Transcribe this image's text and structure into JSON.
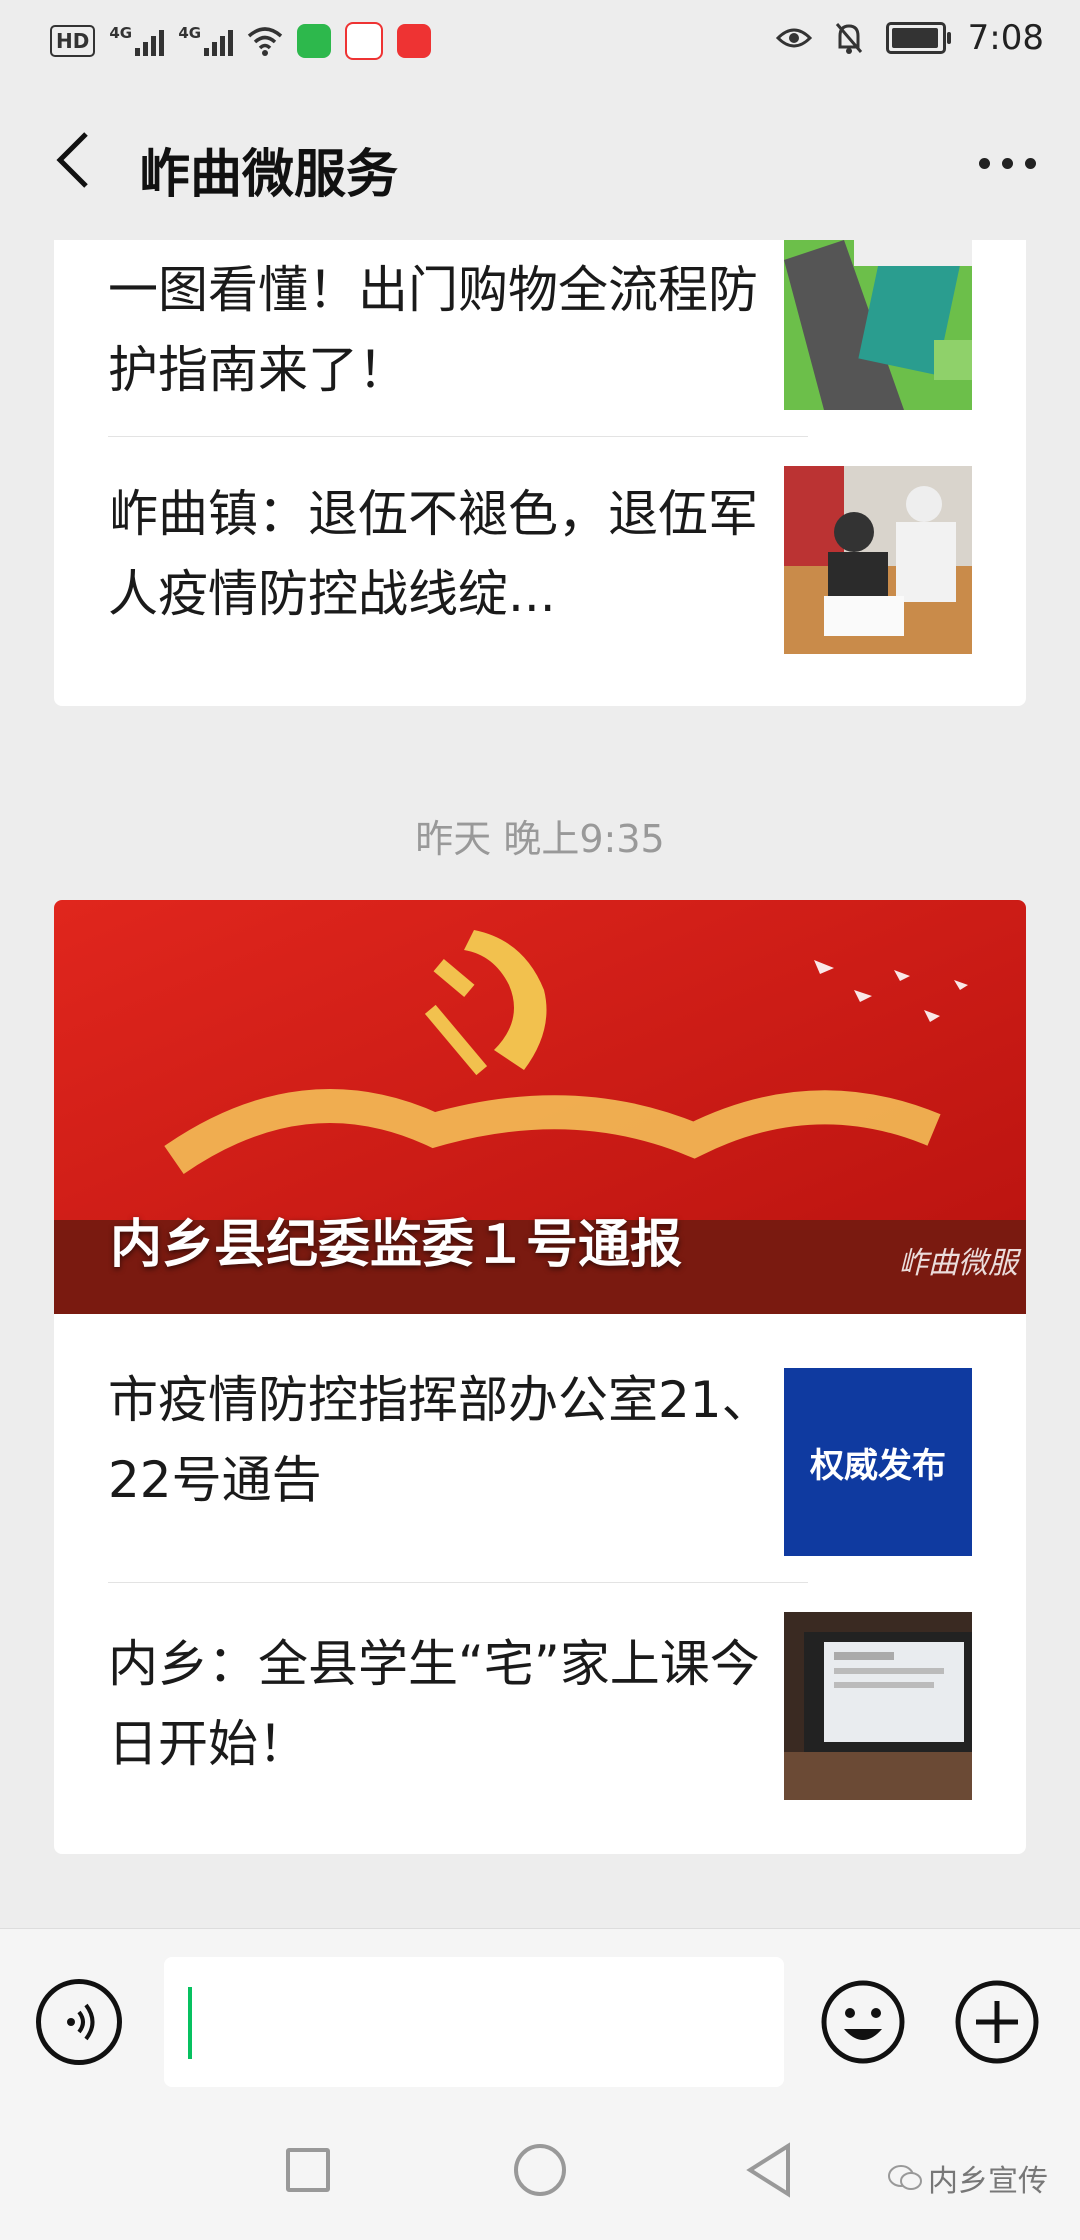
{
  "status_bar": {
    "hd_label": "HD",
    "network_1": "4G",
    "network_2": "4G",
    "time": "7:08"
  },
  "header": {
    "title": "岞曲微服务"
  },
  "card1": {
    "items": [
      {
        "title": "一图看懂！出门购物全流程防护指南来了！"
      },
      {
        "title": "岞曲镇：退伍不褪色，退伍军人疫情防控战线绽..."
      }
    ]
  },
  "timestamp": "昨天 晚上9:35",
  "card2": {
    "banner_title": "内乡县纪委监委１号通报",
    "banner_watermark": "岞曲微服",
    "items": [
      {
        "title": "市疫情防控指挥部办公室21、22号通告",
        "thumb_text": "权威发布"
      },
      {
        "title": "内乡：全县学生“宅”家上课今日开始！"
      }
    ]
  },
  "input": {
    "placeholder": ""
  },
  "watermark_brand": "内乡宣传",
  "colors": {
    "accent": "#07c160",
    "page_bg": "#ededed",
    "banner_red": "#c4161c"
  }
}
